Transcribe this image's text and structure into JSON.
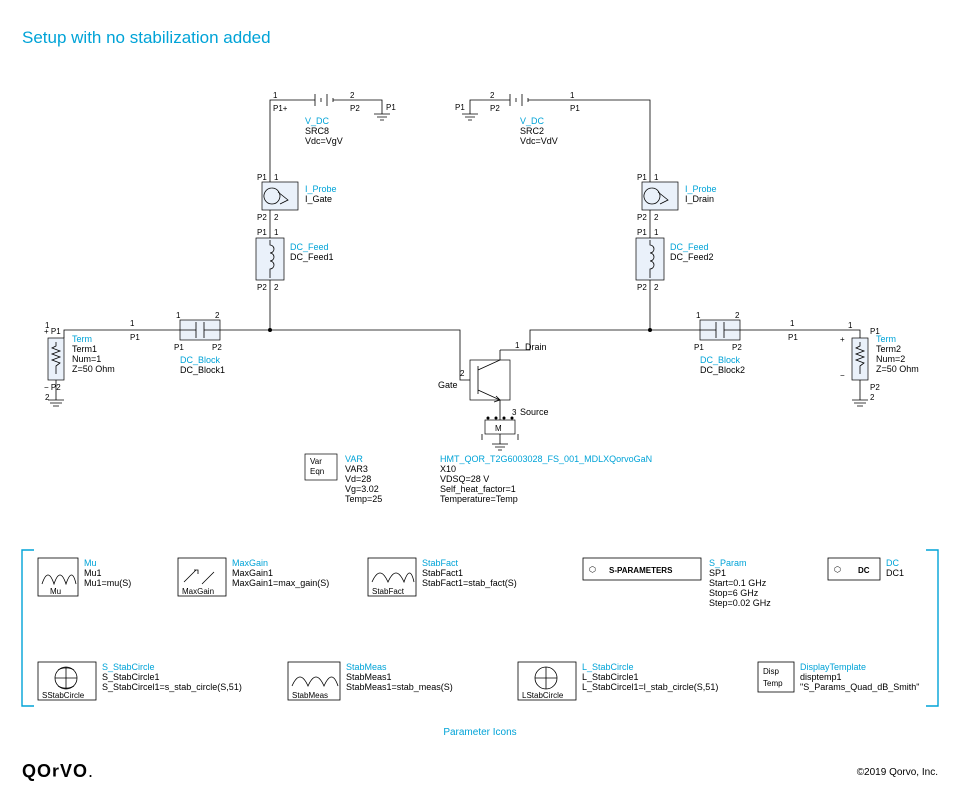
{
  "title": "Setup with no stabilization added",
  "vdc_left": {
    "type": "V_DC",
    "name": "SRC8",
    "val": "Vdc=VgV"
  },
  "vdc_right": {
    "type": "V_DC",
    "name": "SRC2",
    "val": "Vdc=VdV"
  },
  "iprobe_left": {
    "type": "I_Probe",
    "name": "I_Gate"
  },
  "iprobe_right": {
    "type": "I_Probe",
    "name": "I_Drain"
  },
  "dcfeed_left": {
    "type": "DC_Feed",
    "name": "DC_Feed1"
  },
  "dcfeed_right": {
    "type": "DC_Feed",
    "name": "DC_Feed2"
  },
  "dcblock_left": {
    "type": "DC_Block",
    "name": "DC_Block1"
  },
  "dcblock_right": {
    "type": "DC_Block",
    "name": "DC_Block2"
  },
  "term_left": {
    "type": "Term",
    "name": "Term1",
    "num": "Num=1",
    "z": "Z=50 Ohm"
  },
  "term_right": {
    "type": "Term",
    "name": "Term2",
    "num": "Num=2",
    "z": "Z=50 Ohm"
  },
  "varblk": {
    "lbl": "Var\nEqn",
    "type": "VAR",
    "name": "VAR3",
    "l1": "Vd=28",
    "l2": "Vg=3.02",
    "l3": "Temp=25"
  },
  "transistor": {
    "type": "HMT_QOR_T2G6003028_FS_001_MDLXQorvoGaN",
    "name": "X10",
    "l1": "VDSQ=28 V",
    "l2": "Self_heat_factor=1",
    "l3": "Temperature=Temp",
    "pin1": "Drain",
    "pin2": "Gate",
    "pin3": "Source"
  },
  "icons": {
    "mu": {
      "box": "Mu",
      "t": "Mu",
      "n": "Mu1",
      "v": "Mu1=mu(S)"
    },
    "maxgain": {
      "box": "MaxGain",
      "t": "MaxGain",
      "n": "MaxGain1",
      "v": "MaxGain1=max_gain(S)"
    },
    "stabfact": {
      "box": "StabFact",
      "t": "StabFact",
      "n": "StabFact1",
      "v": "StabFact1=stab_fact(S)"
    },
    "sparams": {
      "box": "S-PARAMETERS",
      "t": "S_Param",
      "n": "SP1",
      "l1": "Start=0.1 GHz",
      "l2": "Stop=6 GHz",
      "l3": "Step=0.02 GHz"
    },
    "dc": {
      "box": "DC",
      "t": "DC",
      "n": "DC1"
    },
    "sstab": {
      "box": "SStabCircle",
      "t": "S_StabCircle",
      "n": "S_StabCircle1",
      "v": "S_StabCircel1=s_stab_circle(S,51)"
    },
    "stabmeas": {
      "box": "StabMeas",
      "t": "StabMeas",
      "n": "StabMeas1",
      "v": "StabMeas1=stab_meas(S)"
    },
    "lstab": {
      "box": "LStabCircle",
      "t": "L_StabCircle",
      "n": "L_StabCircle1",
      "v": "L_StabCircel1=l_stab_circle(S,51)"
    },
    "disp": {
      "box": "Disp\nTemp",
      "t": "DisplayTemplate",
      "n": "disptemp1",
      "v": "\"S_Params_Quad_dB_Smith\""
    }
  },
  "paramicons_label": "Parameter Icons",
  "footer": "QOrVO",
  "copyright": "©2019 Qorvo, Inc."
}
